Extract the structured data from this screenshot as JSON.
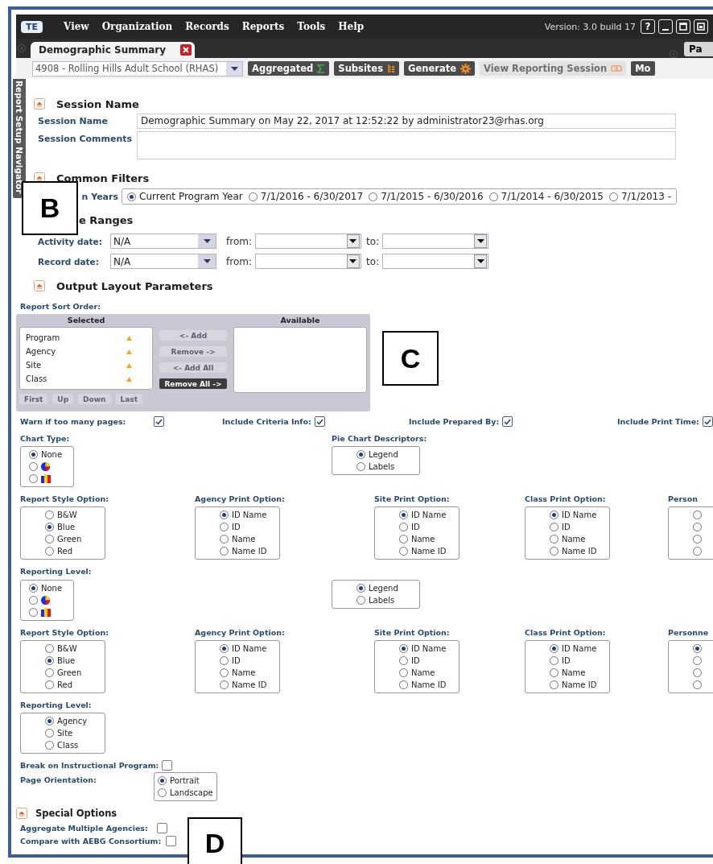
{
  "menu_bar": {
    "logo": "TE",
    "items": [
      {
        "label": "View"
      },
      {
        "label": "Organization"
      },
      {
        "label": "Records"
      },
      {
        "label": "Reports"
      },
      {
        "label": "Tools"
      },
      {
        "label": "Help"
      }
    ],
    "version": "Version: 3.0 build 17",
    "help_key": "?"
  },
  "tabs": [
    {
      "label": "Demographic Summary",
      "selected": true
    }
  ],
  "tab_overflow": "Pa",
  "toolbar": {
    "agency": "4908 - Rolling Hills Adult School (RHAS)",
    "buttons": [
      {
        "label": "Aggregated",
        "kind": "sigma",
        "disabled": false
      },
      {
        "label": "Subsites",
        "kind": "tree",
        "disabled": false
      },
      {
        "label": "Generate",
        "kind": "gear",
        "disabled": false
      },
      {
        "label": "View Reporting Session",
        "kind": "link",
        "disabled": true
      },
      {
        "label": "Mo",
        "kind": "plain",
        "disabled": false
      }
    ]
  },
  "navigator": {
    "label": "Report Setup Navigator"
  },
  "session": {
    "title": "Session Name",
    "name_label": "Session Name",
    "name_value": "Demographic Summary on May 22, 2017 at 12:52:22 by administrator23@rhas.org",
    "comments_label": "Session Comments"
  },
  "common_filters": {
    "title": "Common Filters",
    "program_years": {
      "label": "n Years",
      "options": [
        {
          "label": "Current Program Year",
          "selected": true
        },
        {
          "label": "7/1/2016 - 6/30/2017",
          "selected": false
        },
        {
          "label": "7/1/2015 - 6/30/2016",
          "selected": false
        },
        {
          "label": "7/1/2014 - 6/30/2015",
          "selected": false
        },
        {
          "label": "7/1/2013 -",
          "selected": false
        }
      ]
    }
  },
  "date_ranges": {
    "title": "e Ranges",
    "rows": [
      {
        "label": "Activity date:",
        "value": "N/A",
        "from_label": "from:",
        "to_label": "to:"
      },
      {
        "label": "Record date:",
        "value": "N/A",
        "from_label": "from:",
        "to_label": "to:"
      }
    ]
  },
  "output_layout": {
    "title": "Output Layout Parameters",
    "sort_order": {
      "label": "Report Sort Order:",
      "selected_header": "Selected",
      "available_header": "Available",
      "selected_items": [
        {
          "label": "Program"
        },
        {
          "label": "Agency"
        },
        {
          "label": "Site"
        },
        {
          "label": "Class"
        }
      ],
      "move_buttons": [
        {
          "label": "<- Add",
          "disabled": true
        },
        {
          "label": "Remove ->",
          "disabled": true
        },
        {
          "label": "<- Add All",
          "disabled": true
        },
        {
          "label": "Remove All ->",
          "disabled": false
        }
      ],
      "order_buttons": [
        {
          "label": "First",
          "disabled": true
        },
        {
          "label": "Up",
          "disabled": true
        },
        {
          "label": "Down",
          "disabled": true
        },
        {
          "label": "Last",
          "disabled": true
        }
      ]
    },
    "flags": [
      {
        "label": "Warn if too many pages:",
        "checked": true
      },
      {
        "label": "Include Criteria Info:",
        "checked": true
      },
      {
        "label": "Include Prepared By:",
        "checked": true
      },
      {
        "label": "Include Print Time:",
        "checked": true
      }
    ],
    "option_rows": [
      {
        "groups": [
          {
            "label": "Chart Type:",
            "options": [
              {
                "kind": "text",
                "label": "None",
                "selected": true
              },
              {
                "kind": "pie",
                "selected": false
              },
              {
                "kind": "bar",
                "selected": false
              }
            ]
          },
          {
            "label": "Pie Chart Descriptors:",
            "options": [
              {
                "kind": "text",
                "label": "Legend",
                "selected": true
              },
              {
                "kind": "text",
                "label": "Labels",
                "selected": false
              }
            ]
          }
        ]
      },
      {
        "groups": [
          {
            "label": "Report Style Option:",
            "options": [
              {
                "kind": "text",
                "label": "B&W",
                "selected": false
              },
              {
                "kind": "text",
                "label": "Blue",
                "selected": true
              },
              {
                "kind": "text",
                "label": "Green",
                "selected": false
              },
              {
                "kind": "text",
                "label": "Red",
                "selected": false
              }
            ]
          },
          {
            "label": "Agency Print Option:",
            "options": [
              {
                "kind": "text",
                "label": "ID Name",
                "selected": true
              },
              {
                "kind": "text",
                "label": "ID",
                "selected": false
              },
              {
                "kind": "text",
                "label": "Name",
                "selected": false
              },
              {
                "kind": "text",
                "label": "Name ID",
                "selected": false
              }
            ]
          },
          {
            "label": "Site Print Option:",
            "options": [
              {
                "kind": "text",
                "label": "ID Name",
                "selected": true
              },
              {
                "kind": "text",
                "label": "ID",
                "selected": false
              },
              {
                "kind": "text",
                "label": "Name",
                "selected": false
              },
              {
                "kind": "text",
                "label": "Name ID",
                "selected": false
              }
            ]
          },
          {
            "label": "Class Print Option:",
            "options": [
              {
                "kind": "text",
                "label": "ID Name",
                "selected": true
              },
              {
                "kind": "text",
                "label": "ID",
                "selected": false
              },
              {
                "kind": "text",
                "label": "Name",
                "selected": false
              },
              {
                "kind": "text",
                "label": "Name ID",
                "selected": false
              }
            ]
          },
          {
            "label": "Person",
            "options": [
              {
                "kind": "blank",
                "selected": false
              },
              {
                "kind": "blank",
                "selected": false
              },
              {
                "kind": "blank",
                "selected": false
              },
              {
                "kind": "blank",
                "selected": false
              }
            ]
          }
        ]
      },
      {
        "label": "Reporting Level:",
        "groups": [
          {
            "options": [
              {
                "kind": "text",
                "label": "None",
                "selected": true
              },
              {
                "kind": "pie",
                "selected": false
              },
              {
                "kind": "bar",
                "selected": false
              }
            ]
          },
          {
            "options": [
              {
                "kind": "text",
                "label": "Legend",
                "selected": true
              },
              {
                "kind": "text",
                "label": "Labels",
                "selected": false
              }
            ]
          }
        ]
      },
      {
        "groups": [
          {
            "label": "Report Style Option:",
            "options": [
              {
                "kind": "text",
                "label": "B&W",
                "selected": false
              },
              {
                "kind": "text",
                "label": "Blue",
                "selected": true
              },
              {
                "kind": "text",
                "label": "Green",
                "selected": false
              },
              {
                "kind": "text",
                "label": "Red",
                "selected": false
              }
            ]
          },
          {
            "label": "Agency Print Option:",
            "options": [
              {
                "kind": "text",
                "label": "ID Name",
                "selected": true
              },
              {
                "kind": "text",
                "label": "ID",
                "selected": false
              },
              {
                "kind": "text",
                "label": "Name",
                "selected": false
              },
              {
                "kind": "text",
                "label": "Name ID",
                "selected": false
              }
            ]
          },
          {
            "label": "Site Print Option:",
            "options": [
              {
                "kind": "text",
                "label": "ID Name",
                "selected": true
              },
              {
                "kind": "text",
                "label": "ID",
                "selected": false
              },
              {
                "kind": "text",
                "label": "Name",
                "selected": false
              },
              {
                "kind": "text",
                "label": "Name ID",
                "selected": false
              }
            ]
          },
          {
            "label": "Class Print Option:",
            "options": [
              {
                "kind": "text",
                "label": "ID Name",
                "selected": true
              },
              {
                "kind": "text",
                "label": "ID",
                "selected": false
              },
              {
                "kind": "text",
                "label": "Name",
                "selected": false
              },
              {
                "kind": "text",
                "label": "Name ID",
                "selected": false
              }
            ]
          },
          {
            "label": "Personne",
            "options": [
              {
                "kind": "blank",
                "selected": true
              },
              {
                "kind": "blank",
                "selected": false
              },
              {
                "kind": "blank",
                "selected": false
              },
              {
                "kind": "blank",
                "selected": false
              }
            ]
          }
        ]
      },
      {
        "groups": [
          {
            "label": "Reporting Level:",
            "options": [
              {
                "kind": "text",
                "label": "Agency",
                "selected": true
              },
              {
                "kind": "text",
                "label": "Site",
                "selected": false
              },
              {
                "kind": "text",
                "label": "Class",
                "selected": false
              }
            ]
          }
        ]
      }
    ],
    "break_on_program": {
      "label": "Break on Instructional Program:",
      "checked": false
    },
    "page_orientation": {
      "label": "Page Orientation:",
      "options": [
        {
          "label": "Portrait",
          "selected": true
        },
        {
          "label": "Landscape",
          "selected": false
        }
      ]
    }
  },
  "special_options": {
    "title": "Special Options",
    "flags": [
      {
        "label": "Aggregate Multiple Agencies:",
        "checked": false
      },
      {
        "label": "Compare with AEBG Consortium:",
        "checked": false
      }
    ]
  },
  "callouts": [
    {
      "label": "B"
    },
    {
      "label": "C"
    },
    {
      "label": "D"
    }
  ]
}
